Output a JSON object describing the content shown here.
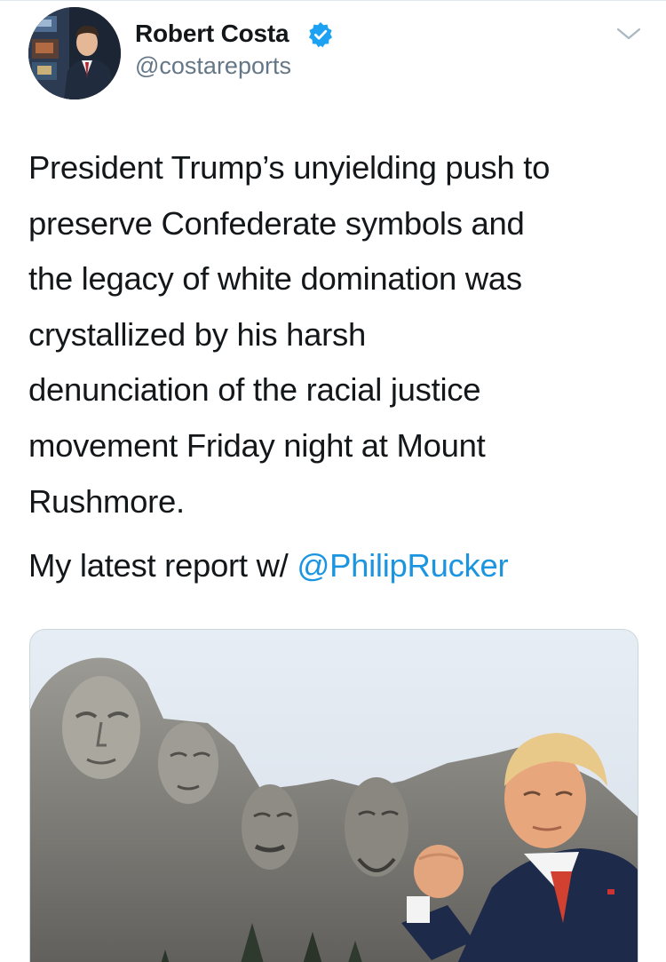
{
  "author": {
    "name": "Robert Costa",
    "handle": "@costareports",
    "verified": true,
    "avatar_icon": "profile-photo"
  },
  "tweet": {
    "lines": [
      "President Trump’s unyielding push to",
      "preserve Confederate symbols and",
      "the legacy of white domination was",
      "crystallized by his harsh",
      "denunciation of the racial justice",
      "movement Friday night at Mount",
      "Rushmore."
    ],
    "report_prefix": "My latest report w/ ",
    "mention": "@PhilipRucker"
  },
  "card": {
    "image_icon": "mount-rushmore-photo"
  },
  "colors": {
    "text": "#14171a",
    "secondary": "#657786",
    "link": "#1b95e0",
    "verified_badge": "#1da1f2",
    "border": "#ccd6dd"
  },
  "icons": {
    "verified": "verified-badge-icon",
    "menu": "chevron-down-icon"
  }
}
